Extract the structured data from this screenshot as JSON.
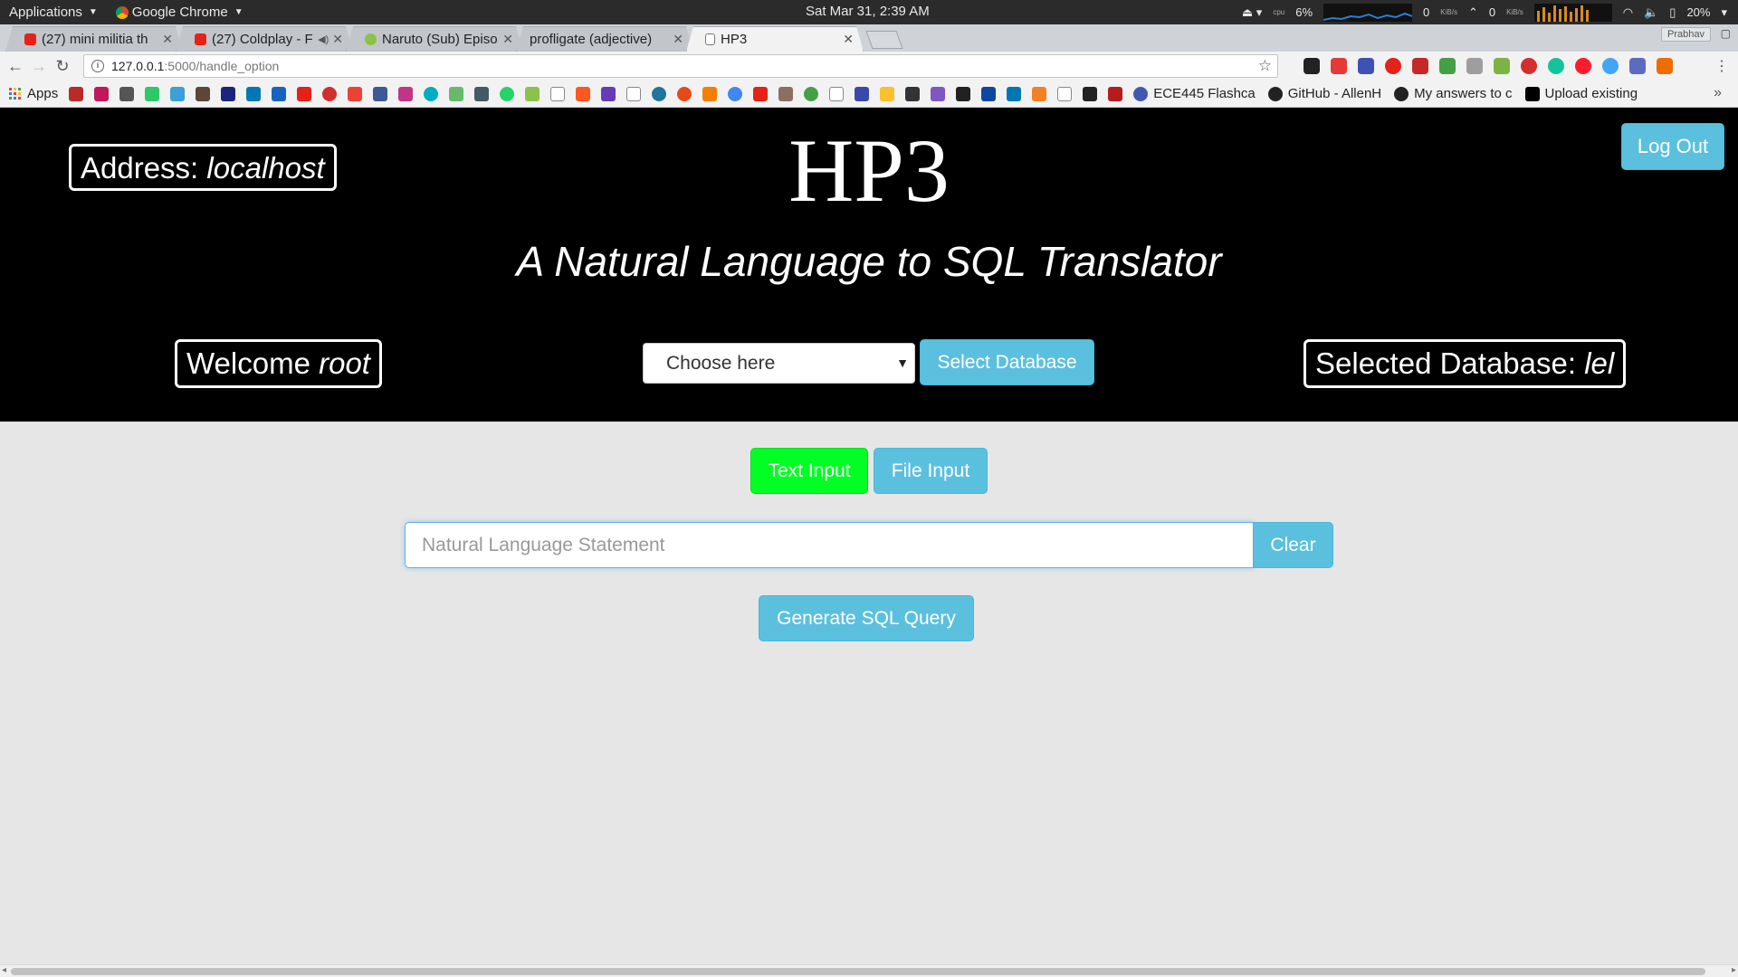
{
  "os": {
    "applications": "Applications",
    "active_app": "Google Chrome",
    "clock": "Sat Mar 31,  2:39 AM",
    "cpu_label": "cpu",
    "cpu_value": "6%",
    "net_down": "0",
    "net_up": "0",
    "net_unit": "KiB/s",
    "battery": "20%"
  },
  "browser": {
    "tabs": [
      {
        "title": "(27) mini militia th",
        "color": "#e62117"
      },
      {
        "title": "(27) Coldplay - F",
        "color": "#e62117"
      },
      {
        "title": "Naruto (Sub) Episo",
        "color": "#8bc34a"
      },
      {
        "title": "profligate (adjective)",
        "color": "#f2f2f2"
      },
      {
        "title": "HP3",
        "color": "#ffffff"
      }
    ],
    "profile": "Prabhav",
    "url_host": "127.0.0.1",
    "url_path": ":5000/handle_option",
    "bookmarks": {
      "apps": "Apps",
      "named": [
        "ECE445 Flashca",
        "GitHub - AllenH",
        "My answers to c",
        "Upload existing"
      ]
    }
  },
  "header": {
    "address_label": "Address: ",
    "address_value": "localhost",
    "title": "HP3",
    "subtitle": "A Natural Language to SQL Translator",
    "logout": "Log Out",
    "welcome_label": "Welcome ",
    "username": "root",
    "db_select_value": "Choose here",
    "select_db_button": "Select Database",
    "selected_db_label": "Selected Database: ",
    "selected_db_value": "lel"
  },
  "main": {
    "text_input_button": "Text Input",
    "file_input_button": "File Input",
    "nl_placeholder": "Natural Language Statement",
    "clear_button": "Clear",
    "generate_button": "Generate SQL Query"
  },
  "colors": {
    "header_bg": "#000000",
    "page_bg": "#e6e6e6",
    "info_button": "#5bc0de",
    "active_mode": "#00ff22"
  }
}
